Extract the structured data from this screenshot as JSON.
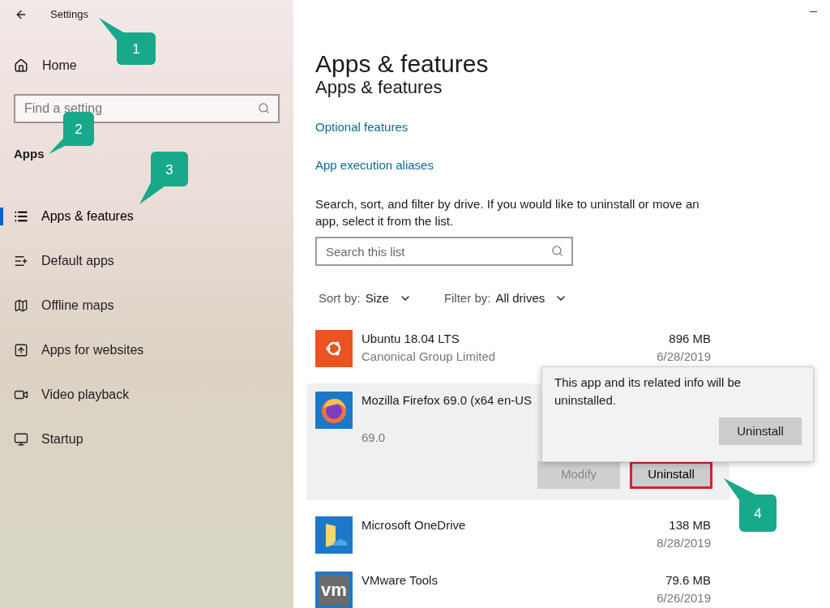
{
  "sidebar": {
    "title": "Settings",
    "home": "Home",
    "search": {
      "placeholder": "Find a setting"
    },
    "section": "Apps",
    "items": [
      {
        "label": "Apps & features",
        "selected": true
      },
      {
        "label": "Default apps",
        "selected": false
      },
      {
        "label": "Offline maps",
        "selected": false
      },
      {
        "label": "Apps for websites",
        "selected": false
      },
      {
        "label": "Video playback",
        "selected": false
      },
      {
        "label": "Startup",
        "selected": false
      }
    ]
  },
  "main": {
    "title": "Apps & features",
    "subtitle": "Apps & features",
    "links": [
      "Optional features",
      "App execution aliases"
    ],
    "description": "Search, sort, and filter by drive. If you would like to uninstall or move an app, select it from the list.",
    "search": {
      "placeholder": "Search this list"
    },
    "sort": {
      "label": "Sort by:",
      "value": "Size"
    },
    "filter": {
      "label": "Filter by:",
      "value": "All drives"
    },
    "apps": [
      {
        "kind": "ubuntu",
        "name": "Ubuntu 18.04 LTS",
        "publisher": "Canonical Group Limited",
        "size": "896 MB",
        "date": "6/28/2019",
        "expanded": false
      },
      {
        "kind": "firefox",
        "name": "Mozilla Firefox 69.0 (x64 en-US",
        "version": "69.0",
        "expanded": true,
        "buttons": [
          {
            "label": "Modify",
            "disabled": true,
            "highlighted": false
          },
          {
            "label": "Uninstall",
            "disabled": false,
            "highlighted": true
          }
        ]
      },
      {
        "kind": "onedrive",
        "name": "Microsoft OneDrive",
        "size": "138 MB",
        "date": "8/28/2019",
        "expanded": false
      },
      {
        "kind": "vmware",
        "name": "VMware Tools",
        "logo_text": "vm",
        "size": "79.6 MB",
        "date": "6/26/2019",
        "expanded": false
      }
    ]
  },
  "popup": {
    "message": "This app and its related info will be uninstalled.",
    "button": "Uninstall"
  },
  "callouts": [
    "1",
    "2",
    "3",
    "4"
  ]
}
